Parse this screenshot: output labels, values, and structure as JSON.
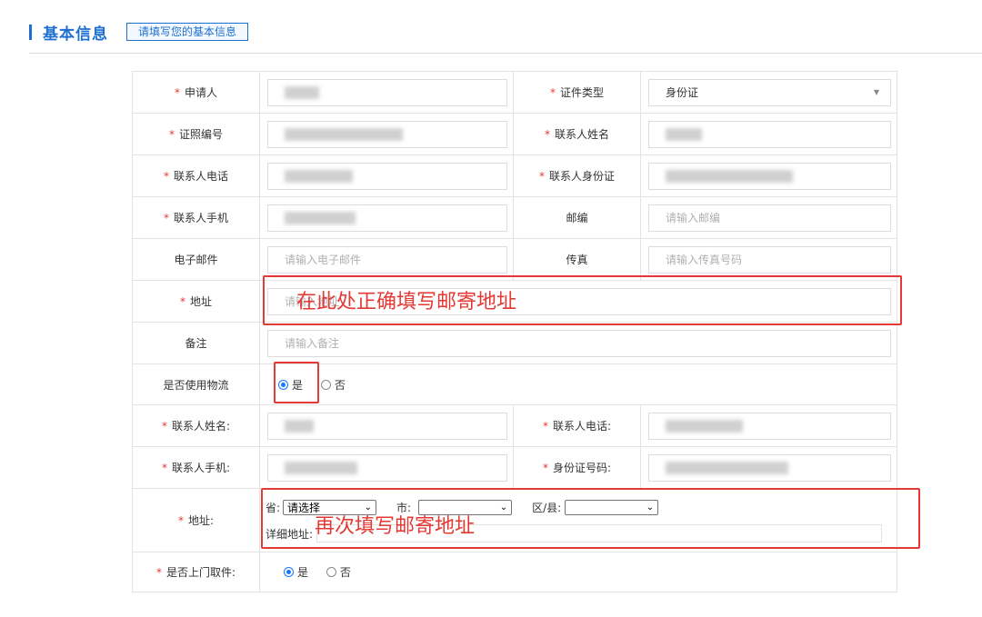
{
  "header": {
    "title": "基本信息",
    "hint": "请填写您的基本信息"
  },
  "form": {
    "applicant_label": "申请人",
    "id_type_label": "证件类型",
    "id_type_value": "身份证",
    "id_number_label": "证照编号",
    "contact_name_label": "联系人姓名",
    "contact_phone_label": "联系人电话",
    "contact_id_label": "联系人身份证",
    "contact_mobile_label": "联系人手机",
    "postcode_label": "邮编",
    "postcode_placeholder": "请输入邮编",
    "email_label": "电子邮件",
    "email_placeholder": "请输入电子邮件",
    "fax_label": "传真",
    "fax_placeholder": "请输入传真号码",
    "address_label": "地址",
    "address_placeholder": "请输入地址",
    "remark_label": "备注",
    "remark_placeholder": "请输入备注",
    "logistics_label": "是否使用物流",
    "yes": "是",
    "no": "否"
  },
  "logistics": {
    "contact_name_label": "联系人姓名:",
    "contact_phone_label": "联系人电话:",
    "contact_mobile_label": "联系人手机:",
    "id_number_label": "身份证号码:",
    "address_label": "地址:",
    "province_label": "省:",
    "province_value": "请选择",
    "city_label": "市:",
    "district_label": "区/县:",
    "detail_label": "详细地址:",
    "pickup_label": "是否上门取件:",
    "yes": "是",
    "no": "否"
  },
  "annotations": {
    "address_note": "在此处正确填写邮寄地址",
    "address_note2": "再次填写邮寄地址",
    "color": "#e53935"
  },
  "colors": {
    "accent": "#1e6fd0",
    "required": "#e53935",
    "radio": "#1677ff"
  }
}
